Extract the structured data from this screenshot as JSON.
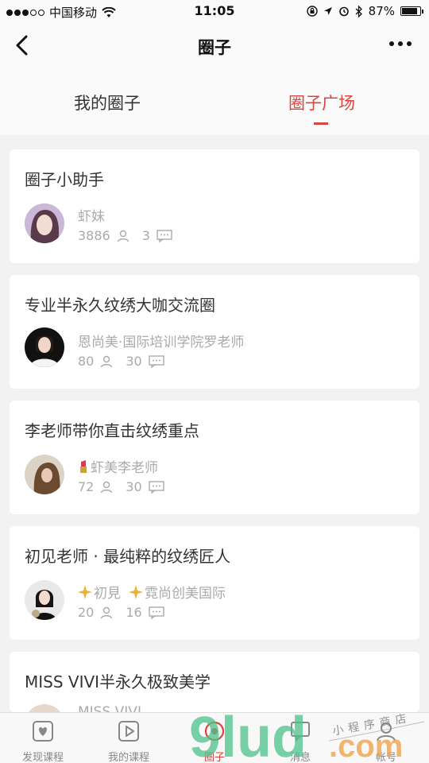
{
  "status": {
    "carrier": "中国移动",
    "time": "11:05",
    "battery": "87%"
  },
  "nav": {
    "title": "圈子"
  },
  "tabs": [
    {
      "label": "我的圈子"
    },
    {
      "label": "圈子广场"
    }
  ],
  "circles": [
    {
      "title": "圈子小助手",
      "owner": "虾妹",
      "members": "3886",
      "posts": "3"
    },
    {
      "title": "专业半永久纹绣大咖交流圈",
      "owner": "恩尚美·国际培训学院罗老师",
      "members": "80",
      "posts": "30"
    },
    {
      "title": "李老师带你直击纹绣重点",
      "owner": "虾美李老师",
      "members": "72",
      "posts": "30"
    },
    {
      "title": "初见老师 · 最纯粹的纹绣匠人",
      "owner_a": "初見",
      "owner_b": "霓尚创美国际",
      "members": "20",
      "posts": "16"
    },
    {
      "title": "MISS VIVI半永久极致美学",
      "owner": "MISS VIVI"
    }
  ],
  "bottom_tabs": [
    {
      "label": "发现课程"
    },
    {
      "label": "我的课程"
    },
    {
      "label": "圈子"
    },
    {
      "label": "消息"
    },
    {
      "label": "帐号"
    }
  ],
  "watermark": {
    "text": "9lud",
    "suffix": ".com",
    "tagline": "小程序商店"
  },
  "colors": {
    "accent": "#d9463f",
    "background": "#f2f2f2",
    "card": "#ffffff"
  }
}
